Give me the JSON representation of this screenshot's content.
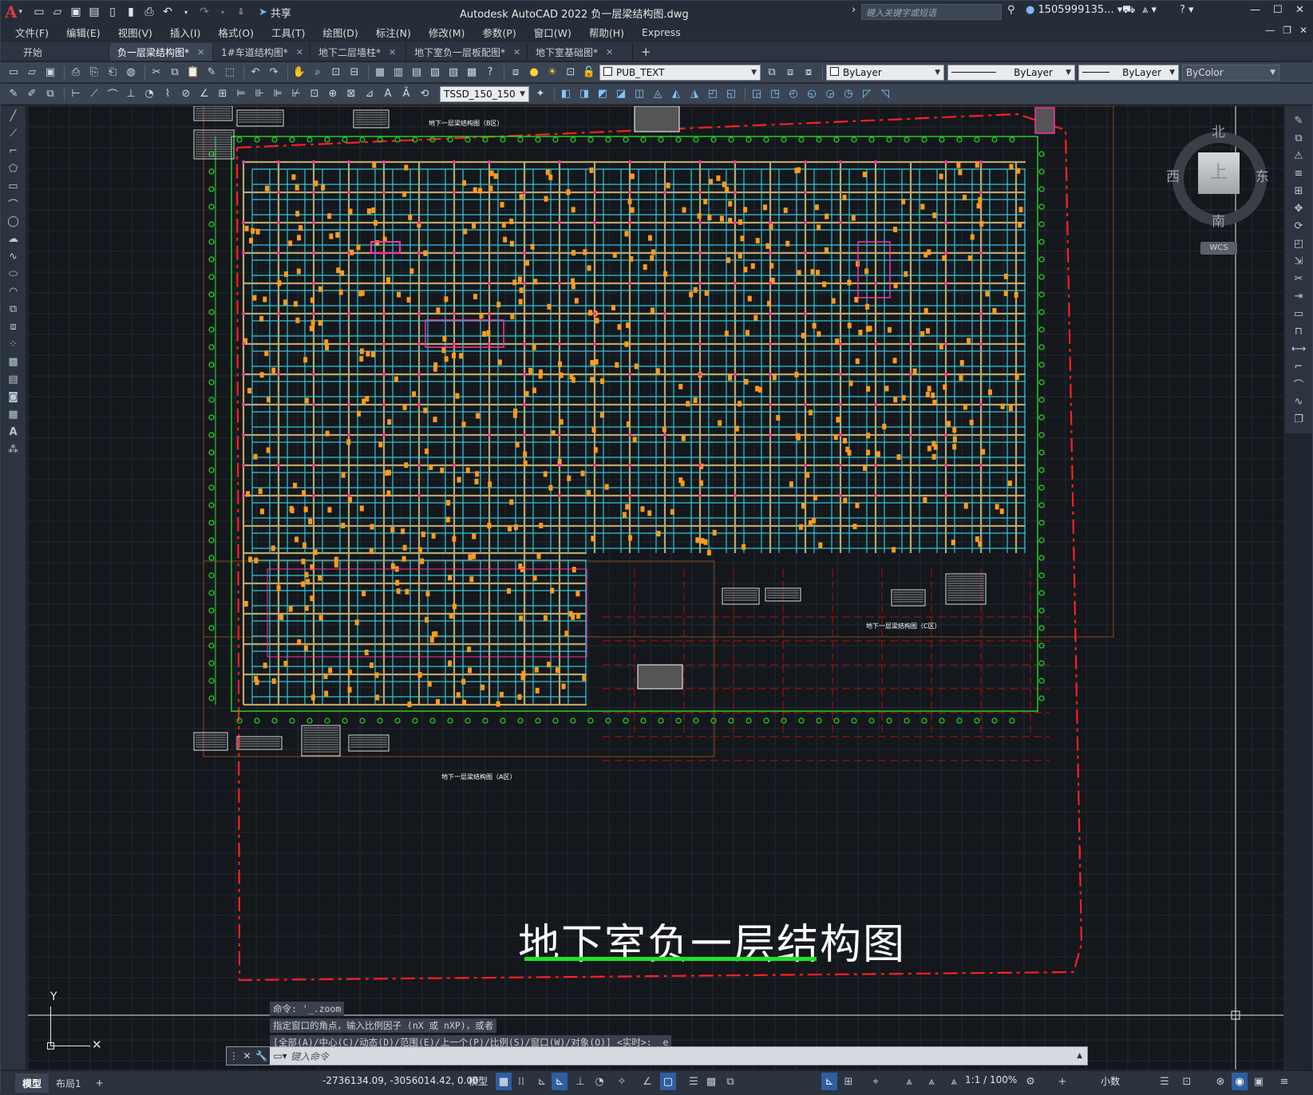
{
  "app": {
    "title": "Autodesk AutoCAD 2022    负一层梁结构图.dwg",
    "share_label": "共享",
    "search_placeholder": "键入关键字或短语",
    "user": "1505999135...",
    "help": "?"
  },
  "menu": [
    "文件(F)",
    "编辑(E)",
    "视图(V)",
    "插入(I)",
    "格式(O)",
    "工具(T)",
    "绘图(D)",
    "标注(N)",
    "修改(M)",
    "参数(P)",
    "窗口(W)",
    "帮助(H)",
    "Express"
  ],
  "tabs": [
    {
      "label": "开始",
      "active": false,
      "closable": false
    },
    {
      "label": "负一层梁结构图*",
      "active": true,
      "closable": true
    },
    {
      "label": "1#车道结构图*",
      "active": false,
      "closable": true
    },
    {
      "label": "地下二层墙柱*",
      "active": false,
      "closable": true
    },
    {
      "label": "地下室负一层板配图*",
      "active": false,
      "closable": true
    },
    {
      "label": "地下室基础图*",
      "active": false,
      "closable": true
    }
  ],
  "toolbar": {
    "layer": "PUB_TEXT",
    "color": "ByLayer",
    "linetype": "ByLayer",
    "lineweight": "ByLayer",
    "plotstyle": "ByColor",
    "dimstyle": "TSSD_150_150"
  },
  "viewcube": {
    "north": "北",
    "south": "南",
    "east": "东",
    "west": "西",
    "top": "上",
    "wcs": "WCS"
  },
  "drawing": {
    "title": "地下室负一层结构图",
    "small_titles": [
      "地下一层梁结构图（B区）",
      "地下一层梁结构图（C区）",
      "地下一层梁结构图（A区）"
    ],
    "ucs_y": "Y"
  },
  "command": {
    "history": [
      "命令: '_.zoom",
      "指定窗口的角点，输入比例因子 (nX 或 nXP)，或者",
      "[全部(A)/中心(C)/动态(D)/范围(E)/上一个(P)/比例(S)/窗口(W)/对象(O)] <实时>: _e"
    ],
    "placeholder": "键入命令"
  },
  "status": {
    "layout_tabs": [
      "模型",
      "布局1"
    ],
    "coords": "-2736134.09, -3056014.42, 0.00",
    "model_label": "模型",
    "scale": "1:1 / 100%",
    "units": "小数"
  },
  "colors": {
    "accent_red": "#e23b3b",
    "grid_green": "#22dd22",
    "beam_cyan": "#2ec8d8",
    "beam_gold": "#b8a86a",
    "dash_red": "#ff2020",
    "magenta": "#ff2fa8",
    "orange": "#ff9a1a"
  }
}
